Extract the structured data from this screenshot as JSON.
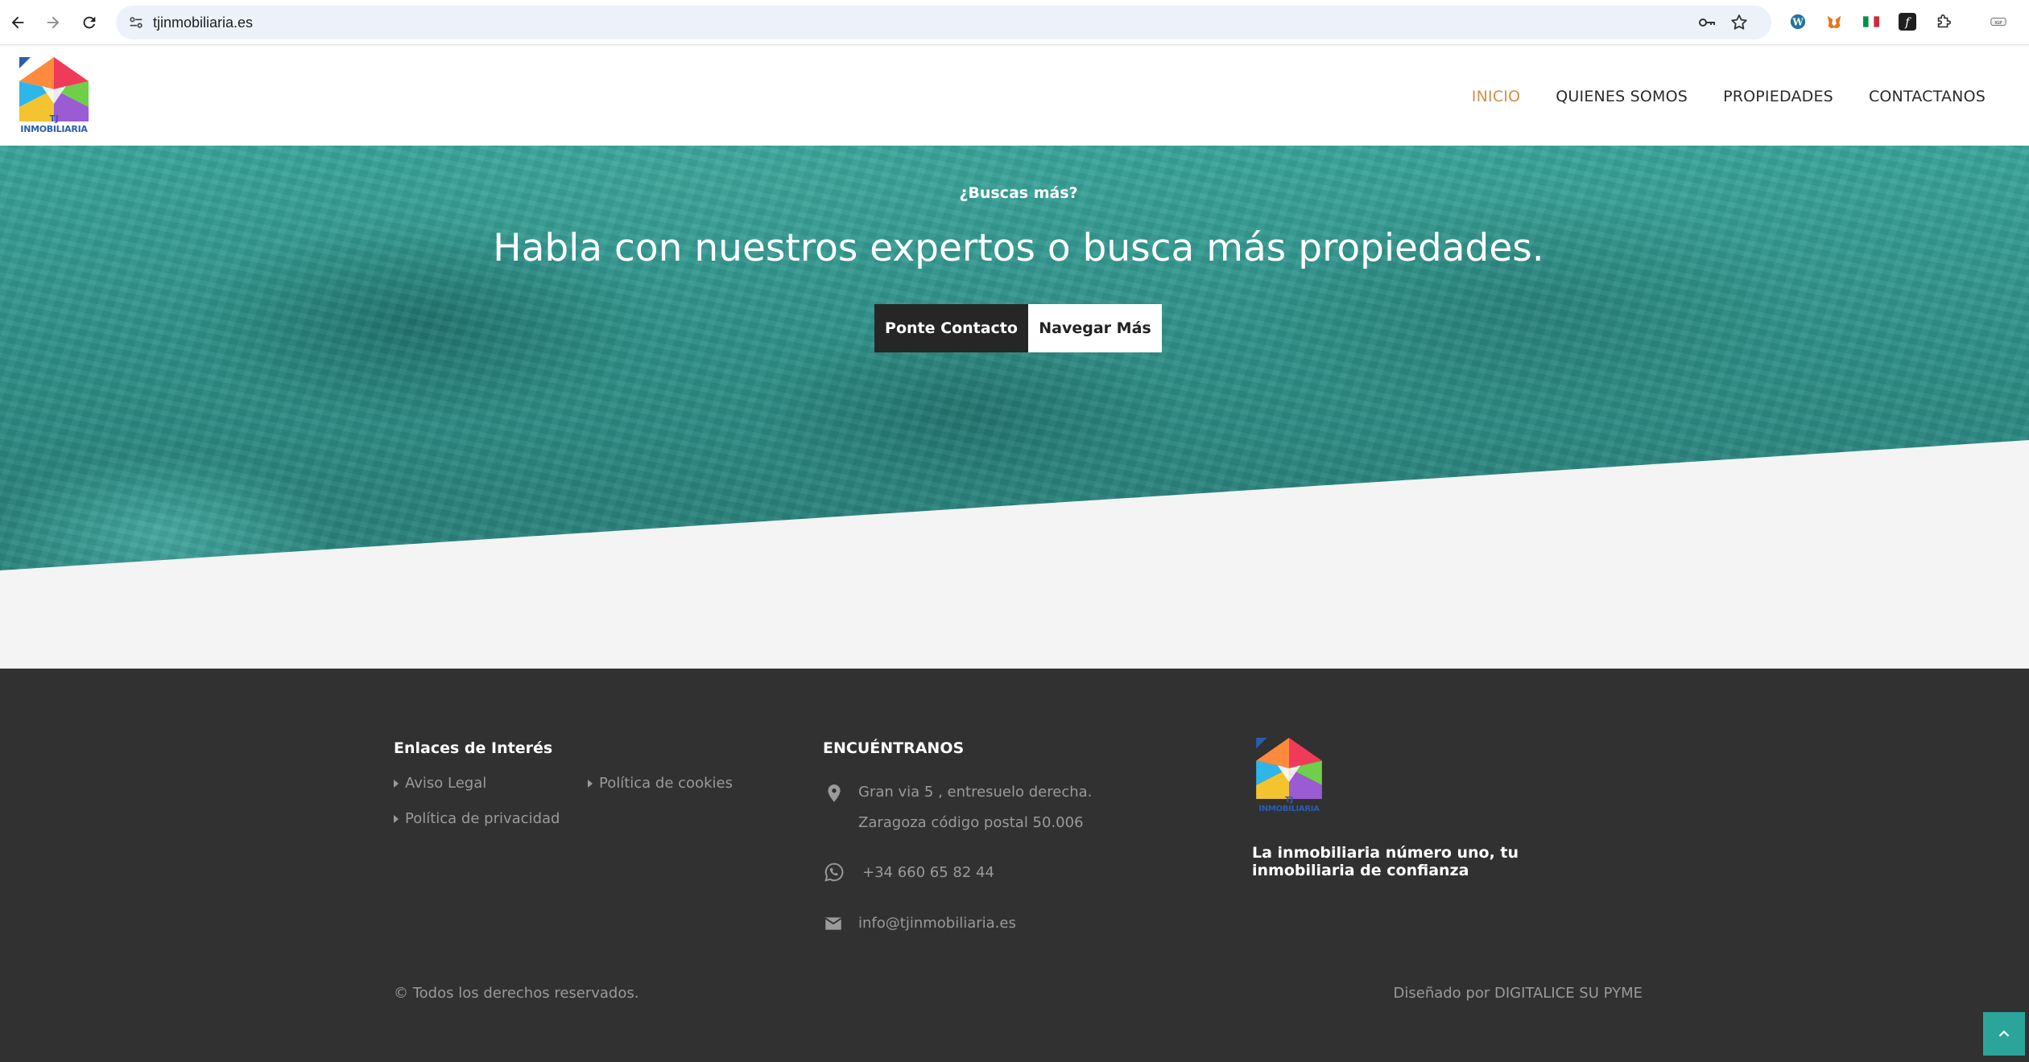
{
  "browser": {
    "url": "tjinmobiliaria.es",
    "icons": [
      "back-arrow-icon",
      "forward-arrow-icon",
      "reload-icon",
      "site-settings-icon",
      "password-key-icon",
      "bookmark-star-icon",
      "wordpress-extension-icon",
      "metamask-extension-icon",
      "italy-flag-extension-icon",
      "fontface-extension-icon",
      "extensions-puzzle-icon",
      "profile-avatar-icon"
    ]
  },
  "header": {
    "logo_text": "TJ INMOBILIARIA",
    "nav": [
      "INICIO",
      "QUIENES SOMOS",
      "PROPIEDADES",
      "CONTACTANOS"
    ],
    "active_nav": "INICIO",
    "active_color": "#d38f4a"
  },
  "hero": {
    "eyebrow": "¿Buscas más?",
    "title": "Habla con nuestros expertos o busca más propiedades.",
    "primary_button": "Ponte Contacto",
    "secondary_button": "Navegar Más",
    "overlay_color": "#2f968d"
  },
  "footer": {
    "links_heading": "Enlaces de Interés",
    "links": [
      "Aviso Legal",
      "Política de cookies",
      "Política de privacidad"
    ],
    "contact_heading": "ENCUÉNTRANOS",
    "address_line1": "Gran via 5 , entresuelo derecha.",
    "address_line2": "Zaragoza código postal 50.006",
    "phone": "+34 660 65 82 44",
    "email": "info@tjinmobiliaria.es",
    "logo_text": "TJ INMOBILIARIA",
    "tagline": "La inmobiliaria número uno, tu inmobiliaria de confianza",
    "copyright": "© Todos los derechos reservados.",
    "credit": "Diseñado por DIGITALICE SU PYME",
    "background": "#313131"
  },
  "back_to_top_color": "#2ba59a"
}
